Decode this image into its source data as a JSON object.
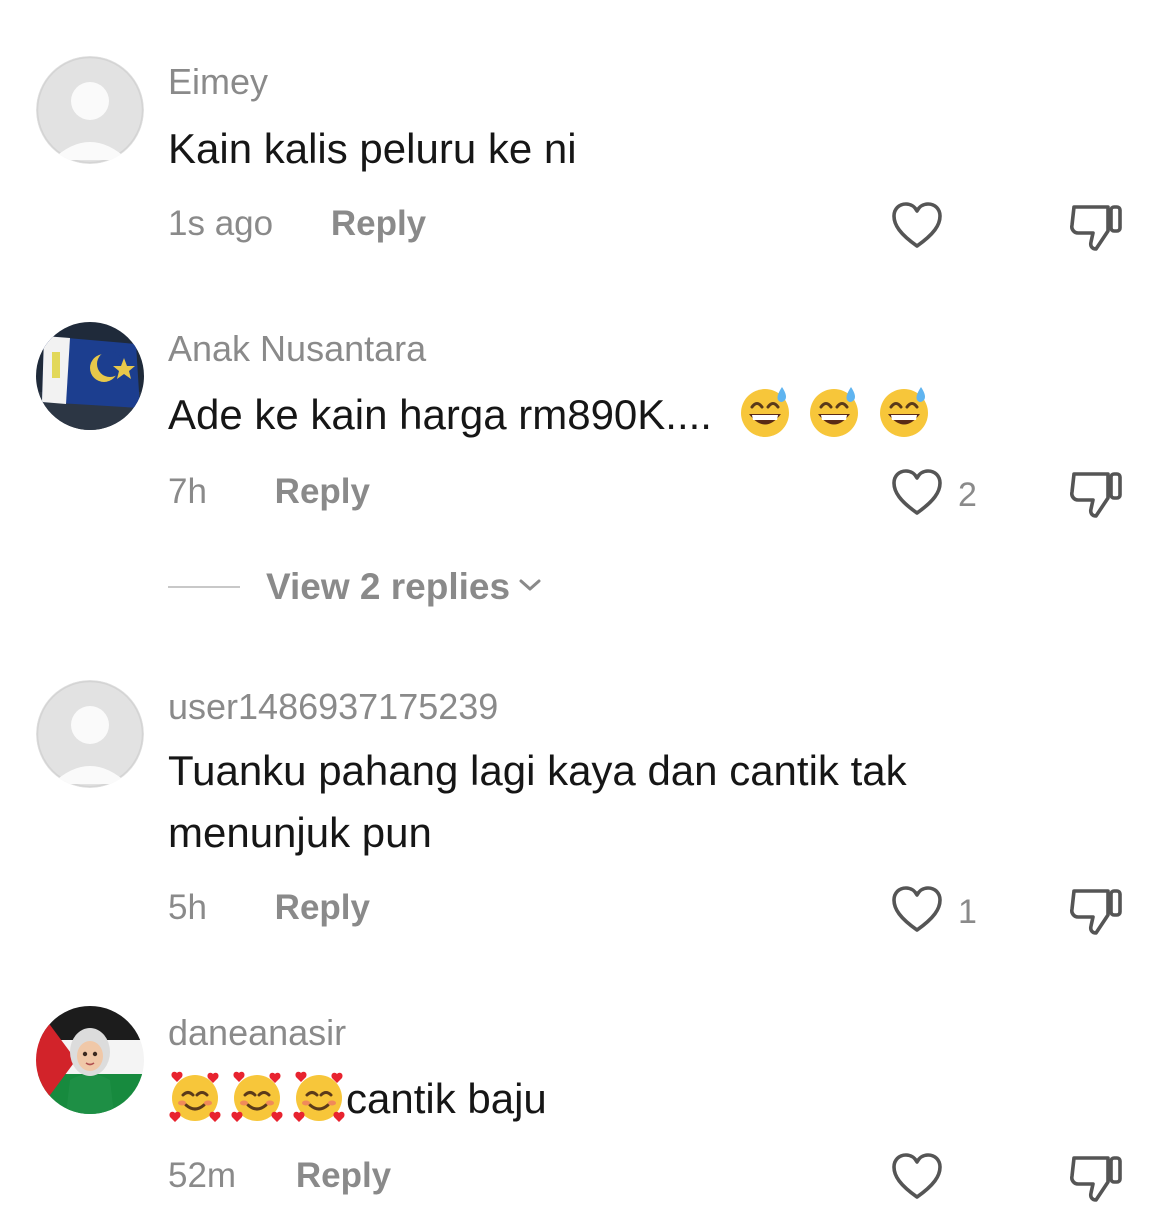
{
  "comments": [
    {
      "username": "Eimey",
      "text": "Kain kalis peluru ke ni",
      "time": "1s ago",
      "reply_label": "Reply",
      "likes": ""
    },
    {
      "username": "Anak Nusantara",
      "text": "Ade ke kain harga rm890K....",
      "emoji": "grinning-face-with-sweat",
      "time": "7h",
      "reply_label": "Reply",
      "likes": "2",
      "view_replies": "View 2 replies"
    },
    {
      "username": "user1486937175239",
      "text_line1": "Tuanku pahang lagi kaya dan cantik tak",
      "text_line2": "menunjuk pun",
      "time": "5h",
      "reply_label": "Reply",
      "likes": "1"
    },
    {
      "username": "daneanasir",
      "text": "cantik baju",
      "emoji": "smiling-face-with-hearts",
      "time": "52m",
      "reply_label": "Reply",
      "likes": ""
    }
  ],
  "icons": {
    "like": "heart-outline-icon",
    "dislike": "thumbs-down-icon",
    "expand": "chevron-down-icon"
  },
  "colors": {
    "muted_text": "#8a8a8a",
    "body_text": "#161616",
    "icon_stroke": "#555555",
    "background": "#ffffff"
  }
}
